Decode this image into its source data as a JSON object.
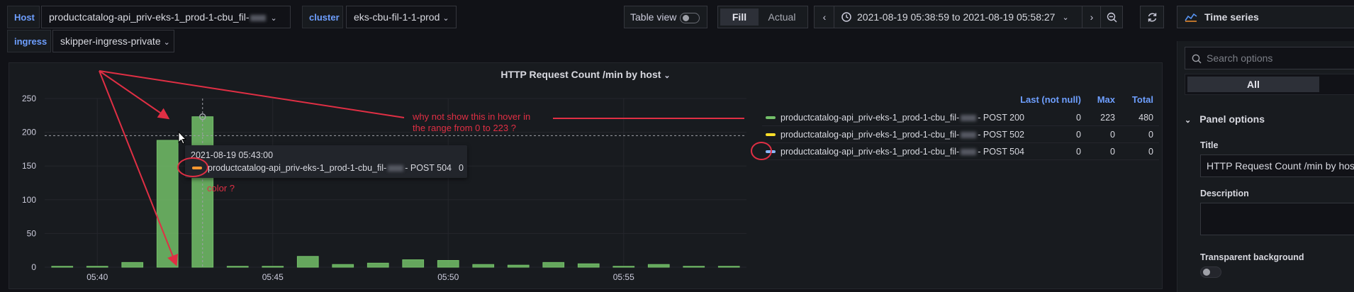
{
  "variables": {
    "host": {
      "label": "Host",
      "value_prefix": "productcatalog-api_priv-eks-1_prod-1-cbu_fil-"
    },
    "cluster": {
      "label": "cluster",
      "value": "eks-cbu-fil-1-1-prod"
    },
    "ingress": {
      "label": "ingress",
      "value": "skipper-ingress-private"
    }
  },
  "toolbar": {
    "table_view": "Table view",
    "fill": "Fill",
    "actual": "Actual",
    "time_range": "2021-08-19 05:38:59 to 2021-08-19 05:58:27",
    "visualization": "Time series"
  },
  "panel": {
    "title": "HTTP Request Count /min by host"
  },
  "chart_data": {
    "type": "bar",
    "title": "HTTP Request Count /min by host",
    "ylim": [
      0,
      250
    ],
    "yticks": [
      0,
      50,
      100,
      150,
      200,
      250
    ],
    "xticks": [
      "05:40",
      "05:45",
      "05:50",
      "05:55"
    ],
    "series": [
      {
        "name": "productcatalog-api_priv-eks-1_prod-1-cbu_fil-… - POST 200",
        "color": "#73bf69",
        "values": [
          0,
          0,
          7,
          188,
          223,
          0,
          0,
          16,
          4,
          6,
          11,
          10,
          4,
          3,
          7,
          5,
          0,
          4,
          0,
          0
        ]
      }
    ]
  },
  "legend": {
    "headers": {
      "last": "Last (not null)",
      "max": "Max",
      "total": "Total"
    },
    "rows": [
      {
        "name_prefix": "productcatalog-api_priv-eks-1_prod-1-cbu_fil-",
        "name_suffix": "- POST 200",
        "color": "#73bf69",
        "last": "0",
        "max": "223",
        "total": "480"
      },
      {
        "name_prefix": "productcatalog-api_priv-eks-1_prod-1-cbu_fil-",
        "name_suffix": "- POST 502",
        "color": "#fade2a",
        "last": "0",
        "max": "0",
        "total": "0"
      },
      {
        "name_prefix": "productcatalog-api_priv-eks-1_prod-1-cbu_fil-",
        "name_suffix": "- POST 504",
        "color": "#8ab8ff",
        "last": "0",
        "max": "0",
        "total": "0"
      }
    ]
  },
  "tooltip": {
    "time": "2021-08-19 05:43:00",
    "series_prefix": "productcatalog-api_priv-eks-1_prod-1-cbu_fil-",
    "series_suffix": "- POST 504",
    "value": "0",
    "color": "#ff9830"
  },
  "annotations": {
    "question_line1": "why not show this in hover in",
    "question_line2": "the range from 0 to 223 ?",
    "color_question": "color ?"
  },
  "options": {
    "search_placeholder": "Search options",
    "all_tab": "All",
    "panel_options": "Panel options",
    "title_label": "Title",
    "title_value": "HTTP Request Count /min by host",
    "description_label": "Description",
    "transparent_label": "Transparent background"
  }
}
